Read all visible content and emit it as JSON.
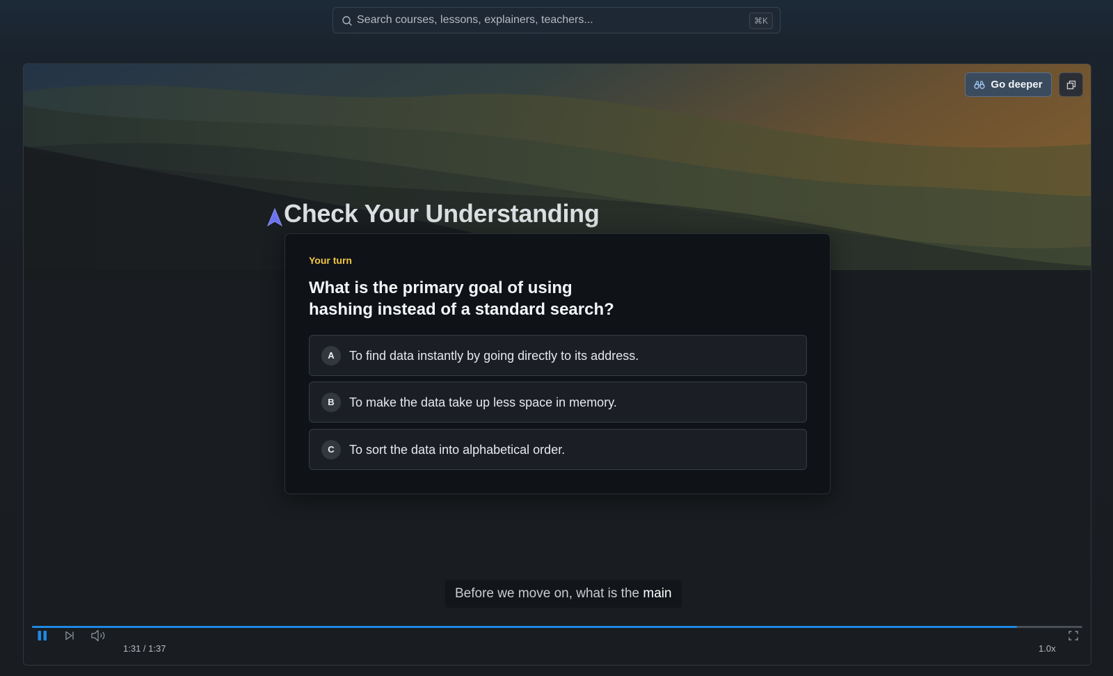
{
  "search": {
    "placeholder": "Search courses, lessons, explainers, teachers...",
    "shortcut": "⌘K"
  },
  "player": {
    "go_deeper_label": "Go deeper",
    "heading": "Check Your Understanding",
    "quiz": {
      "eyebrow": "Your turn",
      "question": "What is the primary goal of using hashing instead of a standard search?",
      "options": [
        {
          "letter": "A",
          "text": "To find data instantly by going directly to its address."
        },
        {
          "letter": "B",
          "text": "To make the data take up less space in memory."
        },
        {
          "letter": "C",
          "text": "To sort the data into alphabetical order."
        }
      ]
    },
    "caption": {
      "text": "Before we move on, what is the ",
      "highlight": "main"
    },
    "controls": {
      "time": "1:31 / 1:37",
      "progress_fraction": 0.938,
      "speed": "1.0x"
    }
  },
  "colors": {
    "accent": "#1e88e5",
    "eyebrow": "#f2c744",
    "cursor": "#6b72f0"
  }
}
